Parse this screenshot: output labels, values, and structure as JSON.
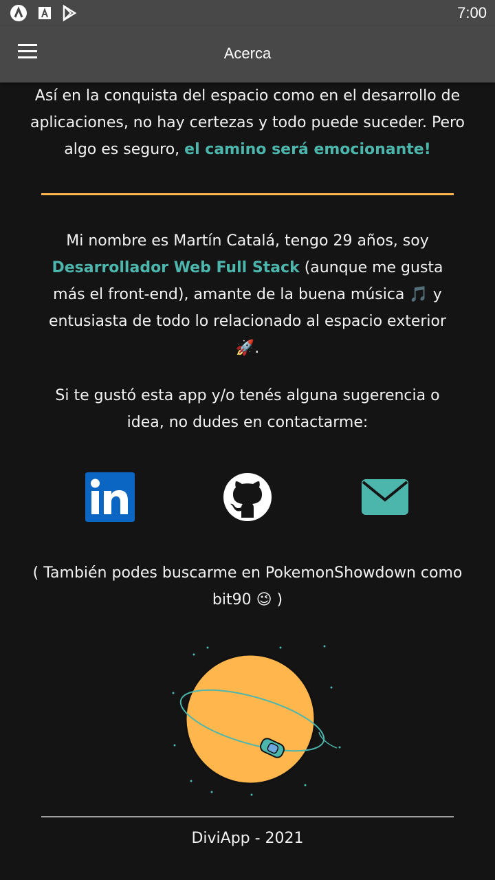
{
  "status": {
    "time": "7:00",
    "icons": [
      "app-icon",
      "font-icon",
      "play-store-icon"
    ]
  },
  "appbar": {
    "title": "Acerca",
    "menu_icon": "hamburger-icon"
  },
  "intro": {
    "text_before": "Así en la conquista del espacio como en el desarrollo de aplicaciones, no hay certezas y todo puede suceder. Pero algo es seguro, ",
    "highlight": "el camino será emocionante!"
  },
  "about": {
    "text_before": "Mi nombre es Martín Catalá, tengo 29 años, soy ",
    "role": "Desarrollador Web Full Stack",
    "text_middle": " (aunque me gusta más el front-end), amante de la buena música ",
    "music_emoji": "🎵",
    "text_after": " y entusiasta de todo lo relacionado al espacio exterior ",
    "rocket_emoji": "🚀",
    "end": "."
  },
  "contact": {
    "text": "Si te gustó esta app y/o tenés alguna sugerencia o idea, no dudes en contactarme:",
    "links": [
      {
        "name": "linkedin",
        "icon": "linkedin-icon",
        "color": "#0a66c2"
      },
      {
        "name": "github",
        "icon": "github-icon",
        "color": "#ffffff"
      },
      {
        "name": "email",
        "icon": "mail-icon",
        "color": "#4db6ac"
      }
    ]
  },
  "showdown": {
    "text": "( También podes buscarme en PokemonShowdown como bit90 ",
    "emoji": "😉",
    "end": " )"
  },
  "illustration": {
    "icon": "planet-astronaut-illustration",
    "planet_color": "#ffb74d",
    "orbit_color": "#4db6ac"
  },
  "footer": {
    "text": "DiviApp - 2021"
  },
  "colors": {
    "accent": "#4db6ac",
    "divider": "#ffb74d",
    "background": "#141414",
    "bar": "#484848"
  }
}
